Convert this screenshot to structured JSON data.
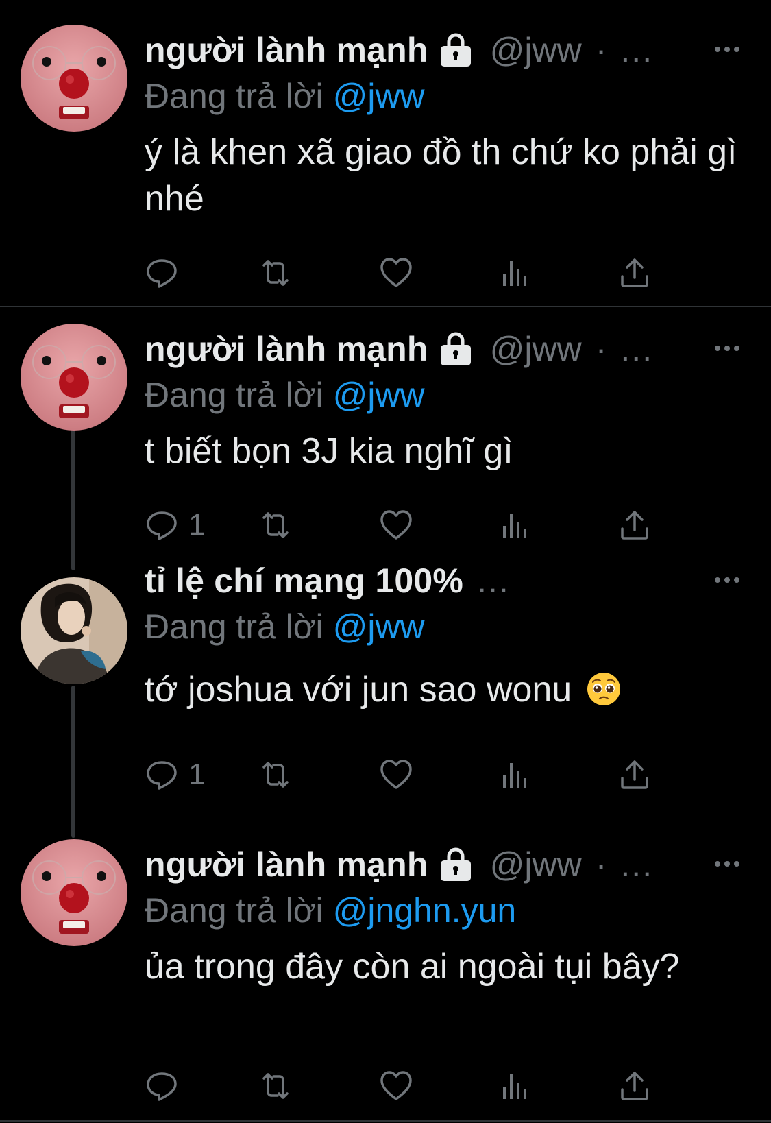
{
  "colors": {
    "background": "#000000",
    "primary_text": "#e7e9ea",
    "secondary_text": "#71767b",
    "link": "#1d9bf0",
    "divider": "#2f3336"
  },
  "replying_prefix": "Đang trả lời",
  "tweets": [
    {
      "avatar": "pink-plush-avatar",
      "display_name": "người lành mạnh",
      "locked": true,
      "handle": "@jww",
      "separator": "·",
      "truncation": "...",
      "reply_to": "@jww",
      "text": "ý là khen xã giao đồ th chứ ko phải gì nhé",
      "reply_count": ""
    },
    {
      "avatar": "pink-plush-avatar",
      "display_name": "người lành mạnh",
      "locked": true,
      "handle": "@jww",
      "separator": "·",
      "truncation": "...",
      "reply_to": "@jww",
      "text": "t biết bọn 3J kia nghĩ gì",
      "reply_count": "1"
    },
    {
      "avatar": "photo-avatar",
      "display_name": "tỉ lệ chí mạng 100%",
      "locked": false,
      "handle": "",
      "separator": "",
      "truncation": "...",
      "reply_to": "@jww",
      "text": "tớ joshua với jun sao wonu",
      "emoji": "pleading-face-emoji",
      "reply_count": "1"
    },
    {
      "avatar": "pink-plush-avatar",
      "display_name": "người lành mạnh",
      "locked": true,
      "handle": "@jww",
      "separator": "·",
      "truncation": "...",
      "reply_to": "@jnghn.yun",
      "text": "ủa trong đây còn ai ngoài tụi bây?",
      "reply_count": ""
    }
  ],
  "icons": {
    "more": "more-horizontal-icon",
    "reply": "reply-icon",
    "retweet": "retweet-icon",
    "like": "like-icon",
    "views": "views-icon",
    "share": "share-icon",
    "lock": "lock-icon"
  }
}
